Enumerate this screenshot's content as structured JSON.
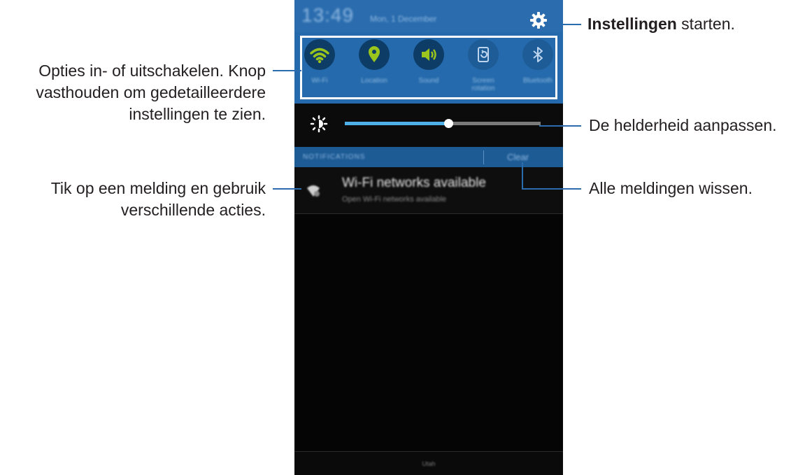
{
  "statusbar": {
    "time": "13:49",
    "date": "Mon, 1 December"
  },
  "quick_settings": [
    {
      "label": "Wi-Fi",
      "icon": "wifi-icon",
      "active": true
    },
    {
      "label": "Location",
      "icon": "location-pin-icon",
      "active": true
    },
    {
      "label": "Sound",
      "icon": "speaker-icon",
      "active": true
    },
    {
      "label": "Screen rotation",
      "icon": "screen-rotation-icon",
      "active": false
    },
    {
      "label": "Bluetooth",
      "icon": "bluetooth-icon",
      "active": false
    }
  ],
  "brightness": {
    "level": 0.53
  },
  "notifications": {
    "header": "NOTIFICATIONS",
    "clear_label": "Clear",
    "items": [
      {
        "title": "Wi-Fi networks available",
        "subtitle": "Open Wi-Fi networks available",
        "icon": "wifi-networks-icon"
      }
    ]
  },
  "bottom_bar": {
    "carrier": "Utah"
  },
  "callouts": {
    "settings_bold": "Instellingen",
    "settings_rest": " starten.",
    "toggles": [
      "Opties in- of uitschakelen. Knop",
      "vasthouden om gedetailleerdere",
      "instellingen te zien."
    ],
    "brightness": "De helderheid aanpassen.",
    "notification": [
      "Tik op een melding en gebruik",
      "verschillende acties."
    ],
    "clear": "Alle meldingen wissen."
  },
  "colors": {
    "accent": "#2a6cae",
    "icon_active": "#9bc51c",
    "icon_inactive": "#8fb8e0",
    "slider": "#4fb0e8"
  }
}
